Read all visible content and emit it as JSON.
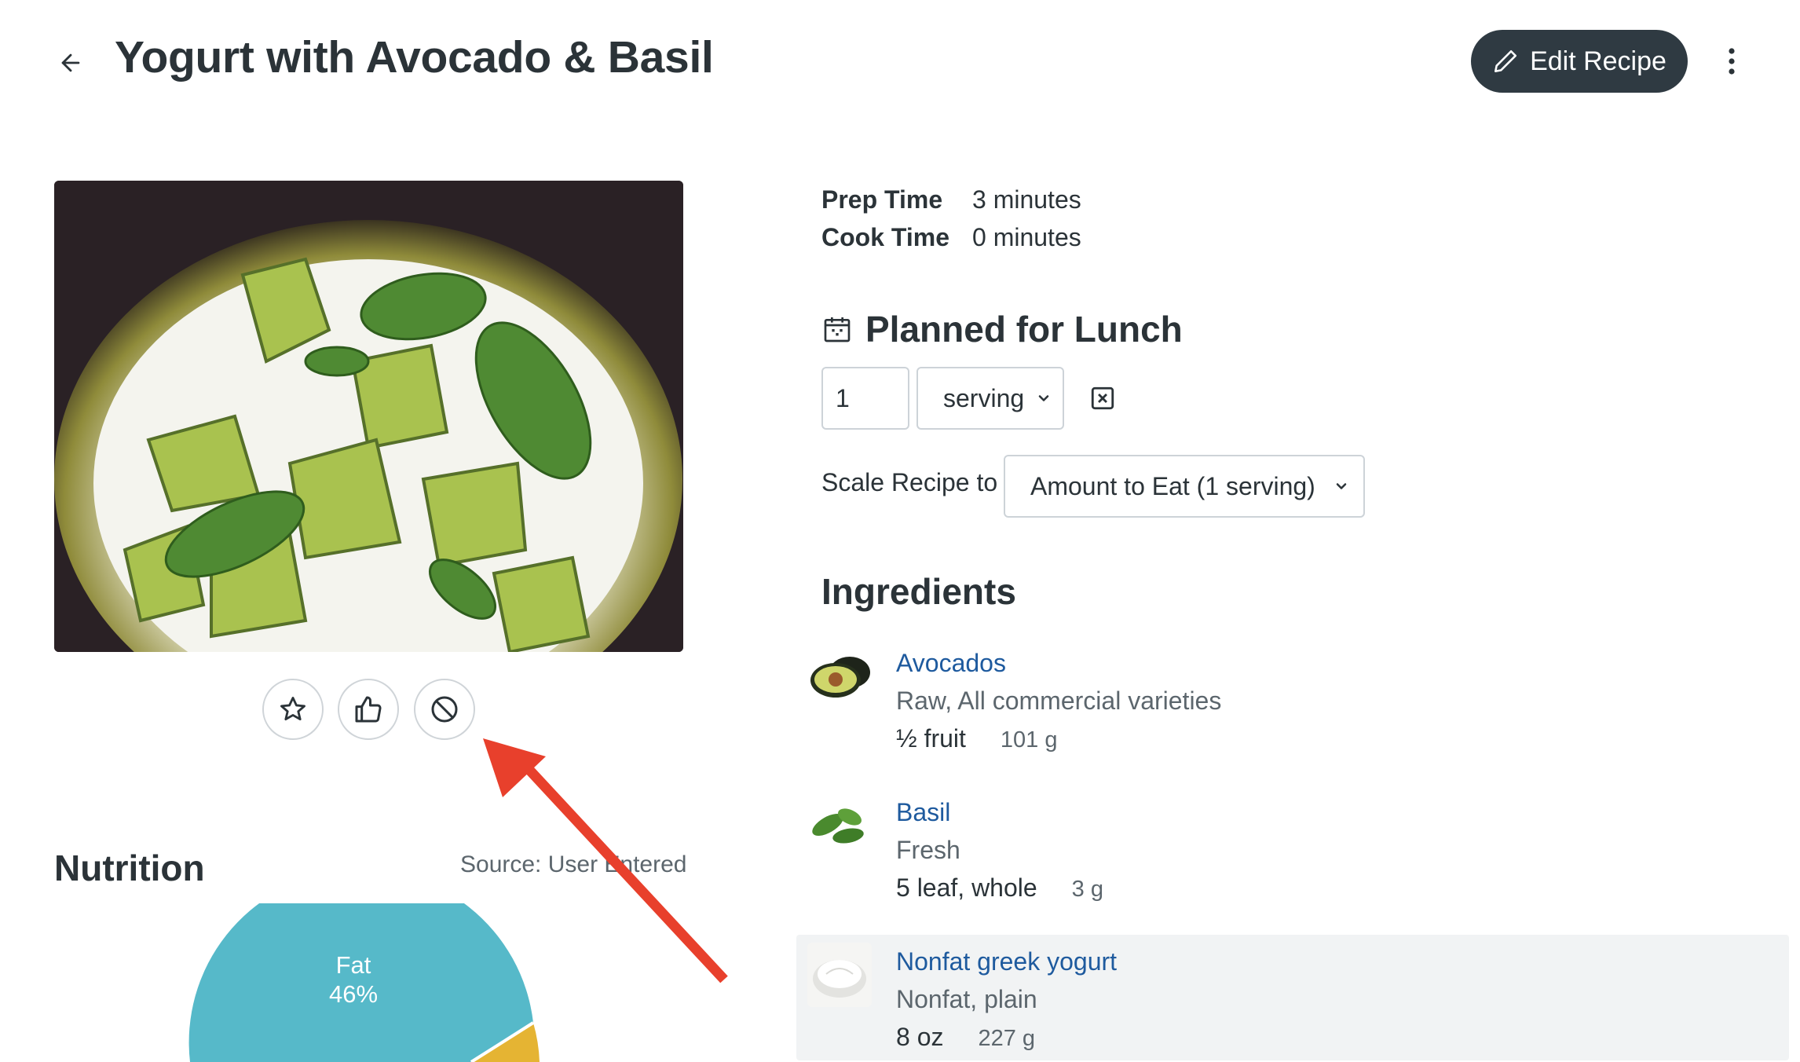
{
  "header": {
    "title": "Yogurt with Avocado & Basil",
    "edit_label": "Edit Recipe",
    "back_icon": "arrow-left-icon",
    "more_icon": "more-vertical-icon"
  },
  "times": {
    "prep_label": "Prep Time",
    "prep_value": "3 minutes",
    "cook_label": "Cook Time",
    "cook_value": "0 minutes"
  },
  "planned": {
    "title": "Planned for Lunch",
    "quantity": "1",
    "unit": "serving",
    "scale_label": "Scale Recipe to",
    "scale_value": "Amount to Eat (1 serving)"
  },
  "ingredients": {
    "title": "Ingredients",
    "items": [
      {
        "name": "Avocados",
        "desc": "Raw, All commercial varieties",
        "amount": "½ fruit",
        "grams": "101 g"
      },
      {
        "name": "Basil",
        "desc": "Fresh",
        "amount": "5 leaf, whole",
        "grams": "3 g"
      },
      {
        "name": "Nonfat greek yogurt",
        "desc": "Nonfat, plain",
        "amount": "8 oz",
        "grams": "227 g"
      }
    ]
  },
  "nutrition": {
    "title": "Nutrition",
    "source": "Source: User Entered",
    "fat_label": "Fat",
    "fat_pct": "46%"
  },
  "rating_icons": [
    "star-icon",
    "thumbs-up-icon",
    "block-icon"
  ],
  "colors": {
    "primary_button": "#2f3a42",
    "link": "#1e5a9e",
    "fat_slice": "#56b9c9",
    "second_slice": "#e5b433",
    "annotation_arrow": "#e8402c"
  }
}
